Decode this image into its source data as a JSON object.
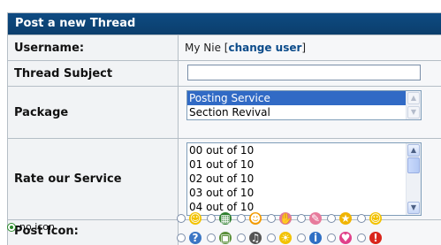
{
  "form": {
    "title": "Post a new Thread",
    "username_label": "Username:",
    "username_value": "My Nie",
    "change_user_open": " [",
    "change_user_link": "change user",
    "change_user_close": "]",
    "subject_label": "Thread Subject",
    "subject_value": "",
    "package_label": "Package",
    "package_options": [
      "Posting Service",
      "Section Revival"
    ],
    "package_selected": "Posting Service",
    "rate_label": "Rate our Service",
    "rate_options": [
      "00 out of 10",
      "01 out of 10",
      "02 out of 10",
      "03 out of 10",
      "04 out of 10"
    ],
    "post_icon_label": "Post Icon:",
    "no_icon_label": "no icon"
  },
  "icons_row1": [
    {
      "name": "smile-icon",
      "glyph": "☺",
      "color": "#f2c200"
    },
    {
      "name": "film-icon",
      "glyph": "▦",
      "color": "#2f7f2f"
    },
    {
      "name": "wink-icon",
      "glyph": "☻",
      "color": "#f29a00"
    },
    {
      "name": "thumbs-down-icon",
      "glyph": "✋",
      "color": "#e07a9a"
    },
    {
      "name": "thought-bubble-icon",
      "glyph": "✎",
      "color": "#e77b9c"
    },
    {
      "name": "star-icon",
      "glyph": "★",
      "color": "#f0b400"
    },
    {
      "name": "grin-icon",
      "glyph": "☺",
      "color": "#f2c200"
    }
  ],
  "icons_row2": [
    {
      "name": "question-icon",
      "glyph": "?",
      "color": "#3b76c4"
    },
    {
      "name": "image-icon",
      "glyph": "▣",
      "color": "#5a8f3a"
    },
    {
      "name": "music-icon",
      "glyph": "♫",
      "color": "#555555"
    },
    {
      "name": "lightbulb-icon",
      "glyph": "☀",
      "color": "#f2c200"
    },
    {
      "name": "info-icon",
      "glyph": "i",
      "color": "#2f6fc4"
    },
    {
      "name": "heart-icon",
      "glyph": "♥",
      "color": "#e0408a"
    },
    {
      "name": "exclamation-icon",
      "glyph": "!",
      "color": "#d9261c"
    }
  ]
}
